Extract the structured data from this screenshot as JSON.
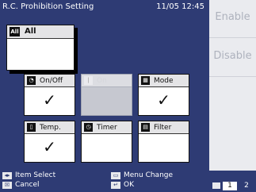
{
  "title_bar": {
    "title": "R.C. Prohibition Setting",
    "datetime": "11/05 12:45"
  },
  "side_buttons": {
    "enable": "Enable",
    "disable": "Disable"
  },
  "all_card": {
    "icon": "all-icon",
    "icon_text": "All",
    "label": "All",
    "checked": false
  },
  "items": [
    {
      "icon": "on-off-icon",
      "icon_text": "◔",
      "label": "On/Off",
      "checked": true,
      "enabled": true
    },
    {
      "icon": "on-icon",
      "icon_text": "|",
      "label": "On",
      "checked": false,
      "enabled": false
    },
    {
      "icon": "mode-icon",
      "icon_text": "▦",
      "label": "Mode",
      "checked": true,
      "enabled": true
    },
    {
      "icon": "temp-icon",
      "icon_text": "▯",
      "label": "Temp.",
      "checked": true,
      "enabled": true
    },
    {
      "icon": "timer-icon",
      "icon_text": "◷",
      "label": "Timer",
      "checked": false,
      "enabled": true
    },
    {
      "icon": "filter-icon",
      "icon_text": "▤",
      "label": "Filter",
      "checked": false,
      "enabled": true
    }
  ],
  "check_mark": "✓",
  "footer": {
    "item_select": "Item Select",
    "cancel": "Cancel",
    "menu_change": "Menu Change",
    "ok": "OK",
    "pages": [
      "1",
      "2"
    ],
    "current_page": "1"
  },
  "colors": {
    "panel": "#2e3b74",
    "side_panel": "#eaebef",
    "side_text": "#aeb2bd",
    "card_head": "#e4e4e6",
    "card_disabled": "#c6c8d0",
    "page_active": "#ffffff"
  }
}
